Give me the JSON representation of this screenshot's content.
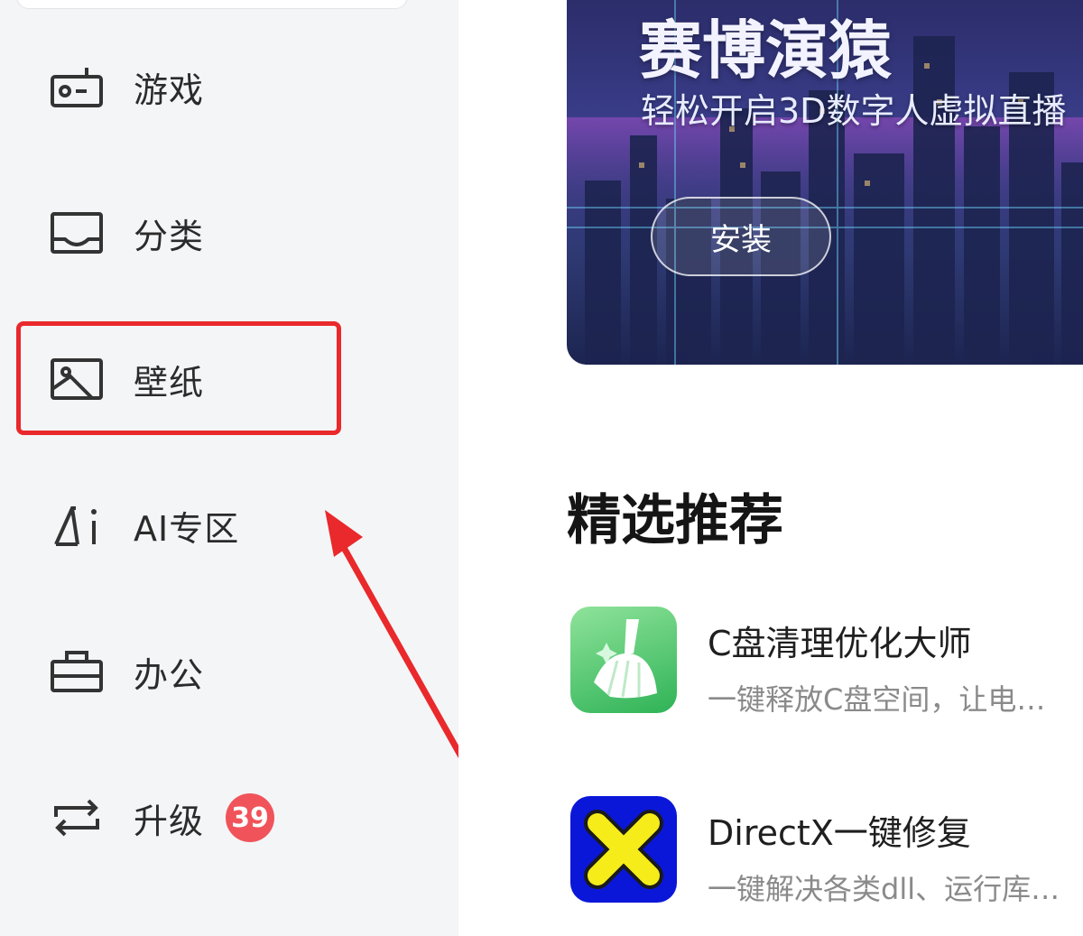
{
  "sidebar": {
    "items": [
      {
        "label": "游戏",
        "icon": "radio-icon"
      },
      {
        "label": "分类",
        "icon": "inbox-icon"
      },
      {
        "label": "壁纸",
        "icon": "image-icon"
      },
      {
        "label": "AI专区",
        "icon": "ai-icon"
      },
      {
        "label": "办公",
        "icon": "briefcase-icon"
      },
      {
        "label": "升级",
        "icon": "swap-arrows-icon",
        "badge": "39"
      }
    ],
    "highlighted_item": "壁纸",
    "highlight_color": "#e9292b"
  },
  "banner": {
    "title": "赛博演猿",
    "subtitle": "轻松开启3D数字人虚拟直播",
    "button_label": "安装"
  },
  "recommend": {
    "title": "精选推荐",
    "apps": [
      {
        "name": "C盘清理优化大师",
        "desc": "一键释放C盘空间，让电脑更流畅",
        "icon": "broom-icon"
      },
      {
        "name": "DirectX一键修复",
        "desc": "一键解决各类dll、运行库问题",
        "icon": "x-cross-icon"
      }
    ]
  },
  "colors": {
    "sidebar_bg": "#f4f5f7",
    "badge": "#f0545a",
    "annotation_red": "#e9292b"
  }
}
